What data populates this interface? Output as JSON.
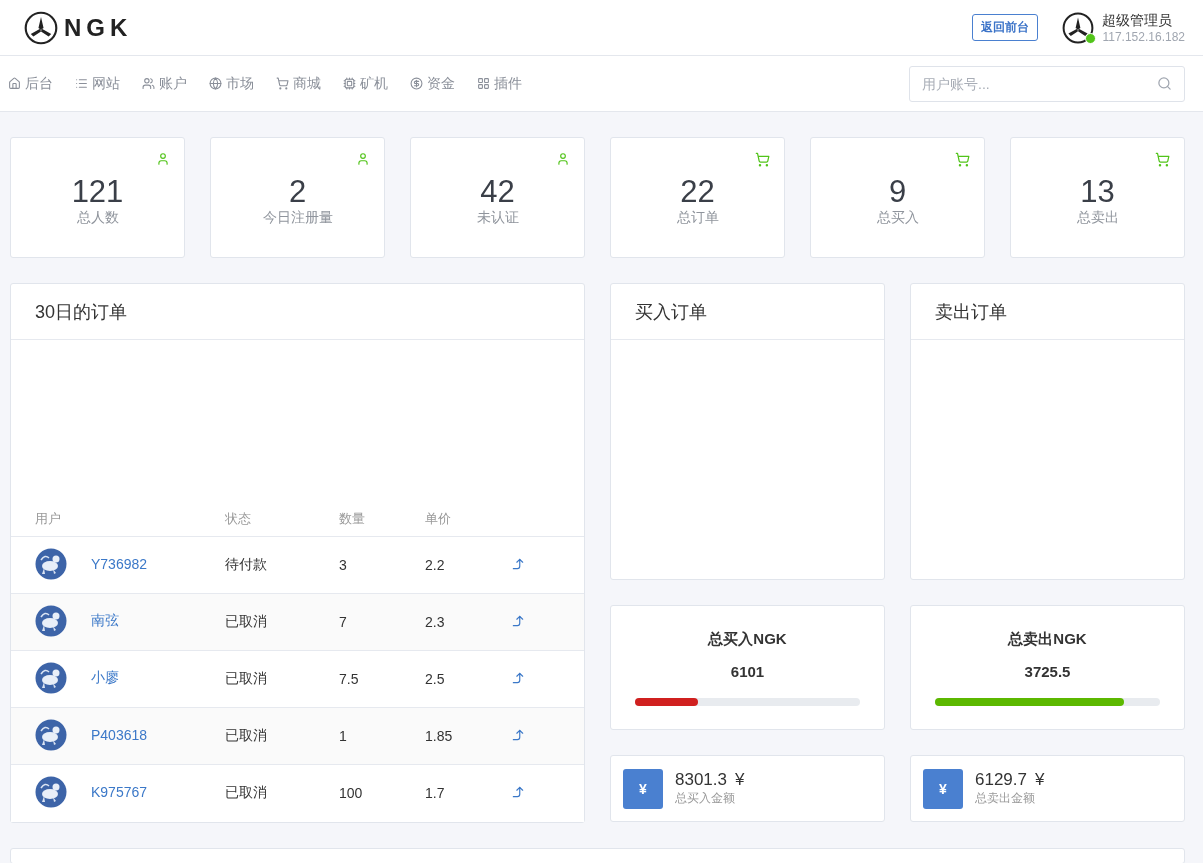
{
  "header": {
    "logo_text": "NGK",
    "back_button": "返回前台",
    "user": {
      "name": "超级管理员",
      "ip": "117.152.16.182",
      "online": true
    }
  },
  "nav": [
    {
      "label": "后台"
    },
    {
      "label": "网站"
    },
    {
      "label": "账户"
    },
    {
      "label": "市场"
    },
    {
      "label": "商城"
    },
    {
      "label": "矿机"
    },
    {
      "label": "资金"
    },
    {
      "label": "插件"
    }
  ],
  "search": {
    "placeholder": "用户账号..."
  },
  "stats": [
    {
      "kind": "user",
      "value": "121",
      "label": "总人数"
    },
    {
      "kind": "user",
      "value": "2",
      "label": "今日注册量"
    },
    {
      "kind": "user",
      "value": "42",
      "label": "未认证"
    },
    {
      "kind": "cart",
      "value": "22",
      "label": "总订单"
    },
    {
      "kind": "cart",
      "value": "9",
      "label": "总买入"
    },
    {
      "kind": "cart",
      "value": "13",
      "label": "总卖出"
    }
  ],
  "orders_panel": {
    "title": "30日的订单",
    "columns": [
      "用户",
      "状态",
      "数量",
      "单价"
    ],
    "rows": [
      {
        "user": "Y736982",
        "status": "待付款",
        "quantity": "3",
        "price": "2.2"
      },
      {
        "user": "南弦",
        "status": "已取消",
        "quantity": "7",
        "price": "2.3"
      },
      {
        "user": "小廖",
        "status": "已取消",
        "quantity": "7.5",
        "price": "2.5"
      },
      {
        "user": "P403618",
        "status": "已取消",
        "quantity": "1",
        "price": "1.85"
      },
      {
        "user": "K975767",
        "status": "已取消",
        "quantity": "100",
        "price": "1.7"
      }
    ]
  },
  "side_panels": [
    {
      "title": "买入订单",
      "total_label": "总买入NGK",
      "total": "6101",
      "level": 0.28,
      "color": "#d0201f",
      "amount": "8301.3",
      "currency": "¥",
      "amount_label": "总买入金额",
      "badge": "¥"
    },
    {
      "title": "卖出订单",
      "total_label": "总卖出NGK",
      "total": "3725.5",
      "level": 0.84,
      "color": "#5cb800",
      "amount": "6129.7",
      "currency": "¥",
      "amount_label": "总卖出金额",
      "badge": "¥"
    }
  ]
}
